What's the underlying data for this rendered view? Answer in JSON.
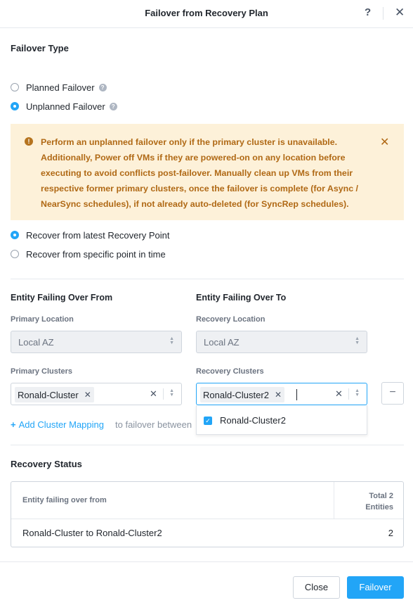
{
  "dialog": {
    "title": "Failover from Recovery Plan",
    "help_icon": "?",
    "close_icon": "✕"
  },
  "failover_type": {
    "title": "Failover Type",
    "options": [
      {
        "label": "Planned Failover",
        "selected": false
      },
      {
        "label": "Unplanned Failover",
        "selected": true
      }
    ]
  },
  "warning": {
    "text": "Perform an unplanned failover only if the primary cluster is unavailable. Additionally, Power off VMs if they are powered-on on any location before executing to avoid conflicts post-failover. Manually clean up VMs from their respective former primary clusters, once the failover is complete (for Async / NearSync schedules), if not already auto-deleted (for SyncRep schedules).",
    "color": "#b06915",
    "background": "#fdf1d9"
  },
  "recover_options": [
    {
      "label": "Recover from latest Recovery Point",
      "selected": true
    },
    {
      "label": "Recover from specific point in time",
      "selected": false
    }
  ],
  "from": {
    "title": "Entity Failing Over From",
    "location_label": "Primary Location",
    "location_value": "Local AZ",
    "clusters_label": "Primary Clusters",
    "cluster_chip": "Ronald-Cluster"
  },
  "to": {
    "title": "Entity Failing Over To",
    "location_label": "Recovery Location",
    "location_value": "Local AZ",
    "clusters_label": "Recovery Clusters",
    "cluster_chip": "Ronald-Cluster2",
    "dropdown_options": [
      {
        "label": "Ronald-Cluster2",
        "checked": true
      }
    ]
  },
  "mapping": {
    "add_label": "Add Cluster Mapping",
    "hint": "to failover between"
  },
  "recovery_status": {
    "title": "Recovery Status",
    "columns": [
      "Entity failing over from",
      "Total 2 Entities"
    ],
    "rows": [
      {
        "entity": "Ronald-Cluster to Ronald-Cluster2",
        "count": "2"
      }
    ]
  },
  "footer": {
    "close_label": "Close",
    "failover_label": "Failover"
  },
  "colors": {
    "accent": "#22a5f7"
  }
}
